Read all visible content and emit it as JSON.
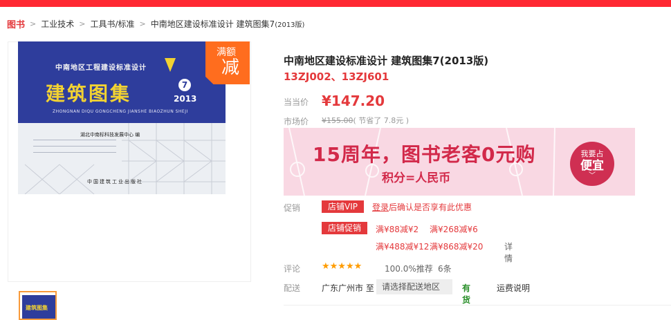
{
  "breadcrumb": {
    "home": "图书",
    "items": [
      "工业技术",
      "工具书/标准"
    ],
    "current_main": "中南地区建设标准设计  建筑图集7",
    "current_small": "(2013版)"
  },
  "cover": {
    "series": "中南地区工程建设标准设计",
    "title": "建筑图集",
    "number": "7",
    "year": "2013",
    "pinyin": "ZHONGNAN DIQU GONGCHENG JIANSHE BIAOZHUN SHEJI",
    "editor": "湖北中南标科技发展中心  编",
    "publisher": "中国建筑工业出版社",
    "thumb_title": "建筑图集"
  },
  "badge": {
    "top": "满额",
    "big": "减"
  },
  "product": {
    "title": "中南地区建设标准设计 建筑图集7(2013版)",
    "subtitle": "13ZJ002、13ZJ601",
    "price_label": "当当价",
    "price": "¥147.20",
    "market_label": "市场价",
    "market_price": "¥155.00",
    "saved": "( 节省了 7.8元 )"
  },
  "banner": {
    "main": "15周年，图书老客0元购",
    "sub": "积分=人民币",
    "circle_1": "我要占",
    "circle_2": "便宜",
    "circle_3": "﹀"
  },
  "promo": {
    "label": "促销",
    "vip_tag": "店铺VIP",
    "login_link": "登录",
    "login_text": "后确认是否享有此优惠",
    "shop_tag": "店铺促销",
    "items": [
      "满¥88减¥2",
      "满¥268减¥6",
      "满¥488减¥12",
      "满¥868减¥20"
    ],
    "detail": "详情"
  },
  "review": {
    "label": "评论",
    "stars": "★★★★★",
    "star_count": 5,
    "rating": "100.0%推荐",
    "count": "6条"
  },
  "shipping": {
    "label": "配送",
    "from": "广东广州市 至",
    "select_placeholder": "请选择配送地区",
    "stock": "有货",
    "fee": "运费说明"
  }
}
